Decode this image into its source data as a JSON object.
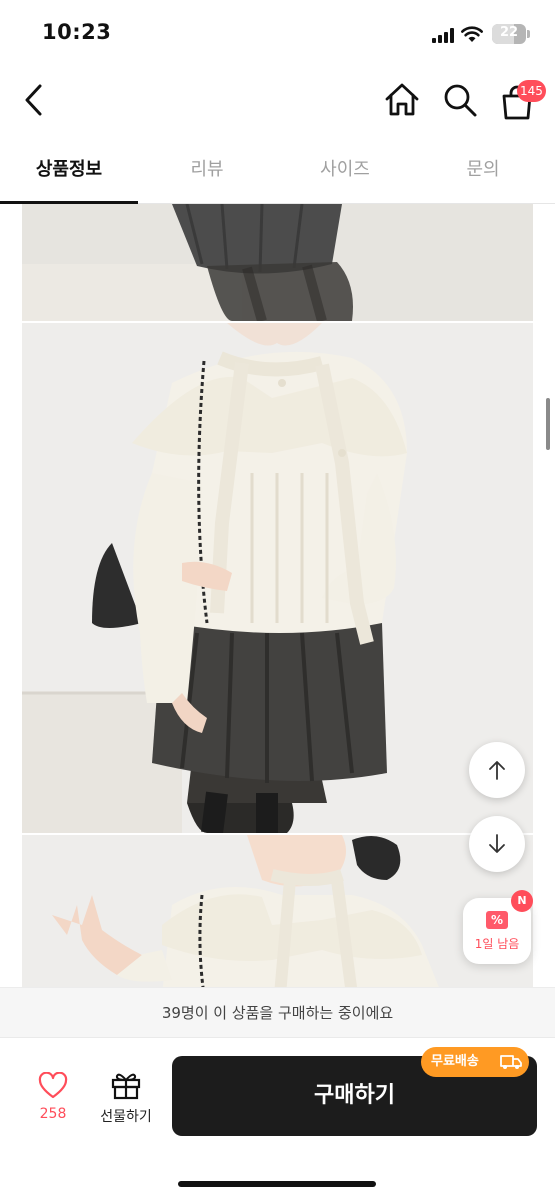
{
  "status_bar": {
    "time": "10:23",
    "battery": "22"
  },
  "header": {
    "cart_count": "145",
    "icons": [
      "back-icon",
      "home-icon",
      "search-icon",
      "shopping-bag-icon"
    ]
  },
  "tabs": [
    {
      "label": "상품정보",
      "active": true
    },
    {
      "label": "리뷰",
      "active": false
    },
    {
      "label": "사이즈",
      "active": false
    },
    {
      "label": "문의",
      "active": false
    }
  ],
  "floating": {
    "scroll_up": "arrow-up-icon",
    "scroll_down": "arrow-down-icon",
    "coupon_label": "1일 남음",
    "coupon_badge": "N"
  },
  "notice": "39명이 이 상품을 구매하는 중이에요",
  "bottom_bar": {
    "like_count": "258",
    "gift_label": "선물하기",
    "buy_label": "구매하기",
    "free_shipping": "무료배송"
  },
  "colors": {
    "accent": "#ff4d5a",
    "buy_button": "#1c1c1c",
    "free_shipping": "#ff9a23"
  }
}
